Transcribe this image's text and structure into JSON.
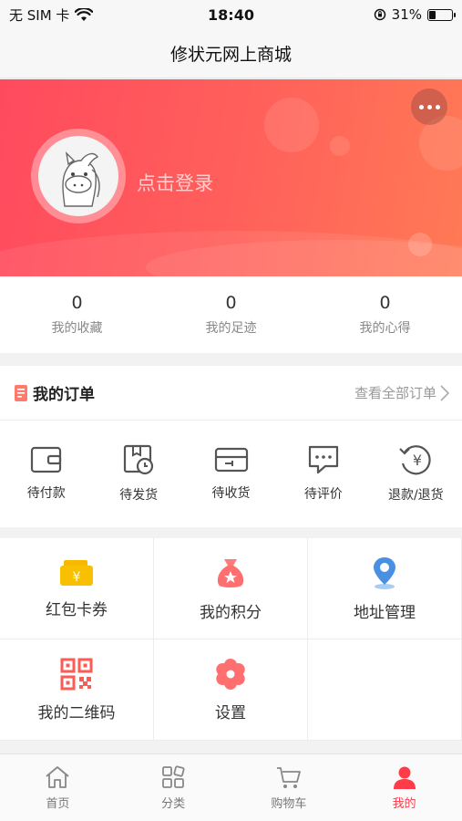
{
  "status_bar": {
    "carrier": "无 SIM 卡",
    "time": "18:40",
    "battery": "31%",
    "battery_level": 0.31
  },
  "nav": {
    "title": "修状元网上商城"
  },
  "profile": {
    "login_text": "点击登录",
    "more_icon": "ellipsis-icon",
    "avatar_icon": "horse-avatar-icon"
  },
  "stats": [
    {
      "value": "0",
      "label": "我的收藏"
    },
    {
      "value": "0",
      "label": "我的足迹"
    },
    {
      "value": "0",
      "label": "我的心得"
    }
  ],
  "orders": {
    "title": "我的订单",
    "view_all": "查看全部订单",
    "items": [
      {
        "label": "待付款",
        "icon": "wallet-icon"
      },
      {
        "label": "待发货",
        "icon": "package-clock-icon"
      },
      {
        "label": "待收货",
        "icon": "card-icon"
      },
      {
        "label": "待评价",
        "icon": "comment-icon"
      },
      {
        "label": "退款/退货",
        "icon": "refund-yen-icon"
      }
    ]
  },
  "features": [
    {
      "label": "红包卡券",
      "icon": "coupon-icon"
    },
    {
      "label": "我的积分",
      "icon": "money-bag-icon"
    },
    {
      "label": "地址管理",
      "icon": "location-pin-icon"
    },
    {
      "label": "我的二维码",
      "icon": "qr-code-icon"
    },
    {
      "label": "设置",
      "icon": "gear-icon"
    }
  ],
  "tabbar": [
    {
      "label": "首页",
      "icon": "home-icon"
    },
    {
      "label": "分类",
      "icon": "category-icon"
    },
    {
      "label": "购物车",
      "icon": "cart-icon"
    },
    {
      "label": "我的",
      "icon": "user-icon",
      "active": true
    }
  ],
  "colors": {
    "accent": "#ff3b49",
    "banner_start": "#ff4a5e",
    "banner_end": "#ff7a55",
    "coupon": "#f8c000",
    "bag": "#ff6f6f",
    "pin": "#4a90e2",
    "qr": "#ff5b55"
  }
}
